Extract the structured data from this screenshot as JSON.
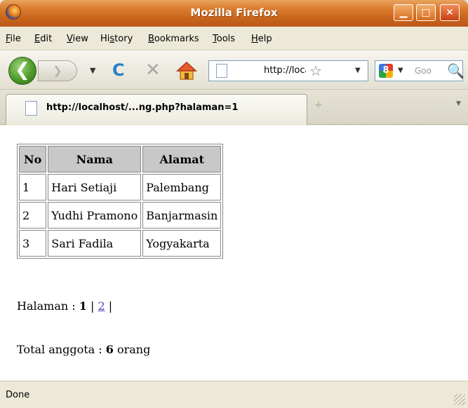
{
  "window": {
    "title": "Mozilla Firefox",
    "min_glyph": "▁",
    "max_glyph": "□",
    "close_glyph": "✕"
  },
  "menu": {
    "items": [
      {
        "pre": "",
        "u": "F",
        "post": "ile"
      },
      {
        "pre": "",
        "u": "E",
        "post": "dit"
      },
      {
        "pre": "",
        "u": "V",
        "post": "iew"
      },
      {
        "pre": "Hi",
        "u": "s",
        "post": "tory"
      },
      {
        "pre": "",
        "u": "B",
        "post": "ookmarks"
      },
      {
        "pre": "",
        "u": "T",
        "post": "ools"
      },
      {
        "pre": "",
        "u": "H",
        "post": "elp"
      }
    ]
  },
  "toolbar": {
    "back_glyph": "❮",
    "forward_glyph": "❯",
    "reload_glyph": "C",
    "stop_glyph": "✕",
    "url": "http://localhost/",
    "search_placeholder": "Goo",
    "google_glyph": "8"
  },
  "tab": {
    "label": "http://localhost/...ng.php?halaman=1",
    "new_glyph": "+"
  },
  "table": {
    "headers": [
      "No",
      "Nama",
      "Alamat"
    ],
    "rows": [
      [
        "1",
        "Hari Setiaji",
        "Palembang"
      ],
      [
        "2",
        "Yudhi Pramono",
        "Banjarmasin"
      ],
      [
        "3",
        "Sari Fadila",
        "Yogyakarta"
      ]
    ]
  },
  "pagination": {
    "label": "Halaman : ",
    "current": "1",
    "sep": " | ",
    "link": "2",
    "end": " |"
  },
  "summary": {
    "label": "Total anggota : ",
    "count": "6",
    "unit": " orang"
  },
  "status": {
    "text": "Done"
  },
  "colors": {
    "titlebar": "#d97a2c",
    "link": "#5a3fb4",
    "table_header": "#c8c8c8"
  }
}
